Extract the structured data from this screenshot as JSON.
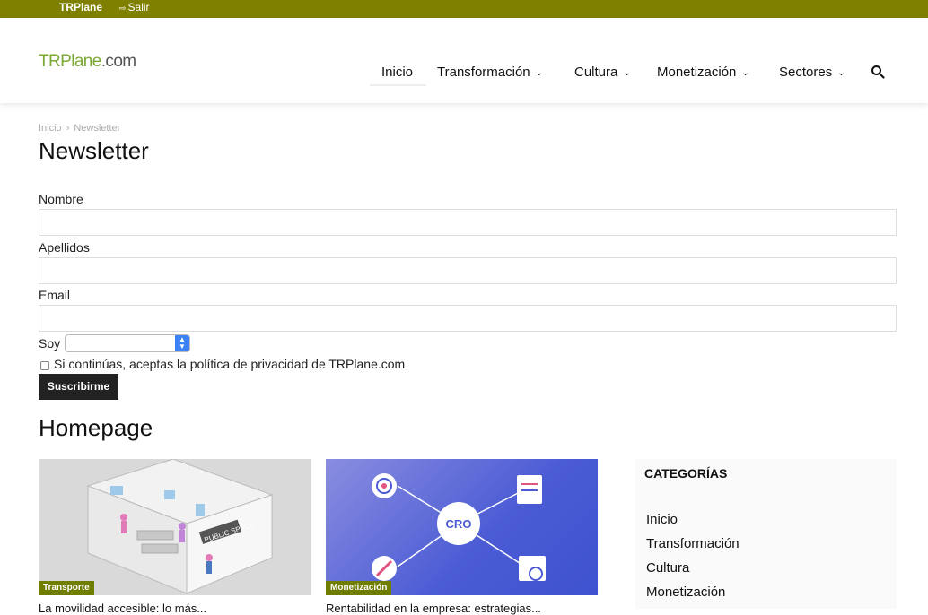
{
  "adminbar": {
    "site": "TRPlane",
    "logout": "Salir",
    "logout_icon": "logout-arrow-icon"
  },
  "header": {
    "logo_part1": "TRPlane",
    "logo_part2": ".com",
    "nav": [
      {
        "label": "Inicio",
        "dropdown": false
      },
      {
        "label": "Transformación",
        "dropdown": true
      },
      {
        "label": "Cultura",
        "dropdown": true
      },
      {
        "label": "Monetización",
        "dropdown": true
      },
      {
        "label": "Sectores",
        "dropdown": true
      }
    ],
    "search_icon": "search-icon",
    "chevron": "⌄"
  },
  "breadcrumb": {
    "home": "Inicio",
    "sep": "›",
    "current": "Newsletter"
  },
  "page_title": "Newsletter",
  "form": {
    "nombre_label": "Nombre",
    "apellidos_label": "Apellidos",
    "email_label": "Email",
    "soy_label": "Soy",
    "soy_value": "",
    "consent": "Si continúas, aceptas la política de privacidad de TRPlane.com",
    "consent_checked": false,
    "submit": "Suscribirme"
  },
  "homepage": {
    "title": "Homepage",
    "cards": [
      {
        "tag": "Transporte",
        "image_text": "PUBLIC SPACE",
        "title_fragment": "La movilidad accesible: lo más..."
      },
      {
        "tag": "Monetización",
        "image_text": "CRO",
        "title_fragment": "Rentabilidad en la empresa: estrategias..."
      }
    ]
  },
  "sidebar": {
    "title": "CATEGORÍAS",
    "items": [
      "Inicio",
      "Transformación",
      "Cultura",
      "Monetización"
    ]
  },
  "colors": {
    "adminbar": "#7f8000",
    "tag": "#6f7d00",
    "logo_green": "#7aa832"
  }
}
